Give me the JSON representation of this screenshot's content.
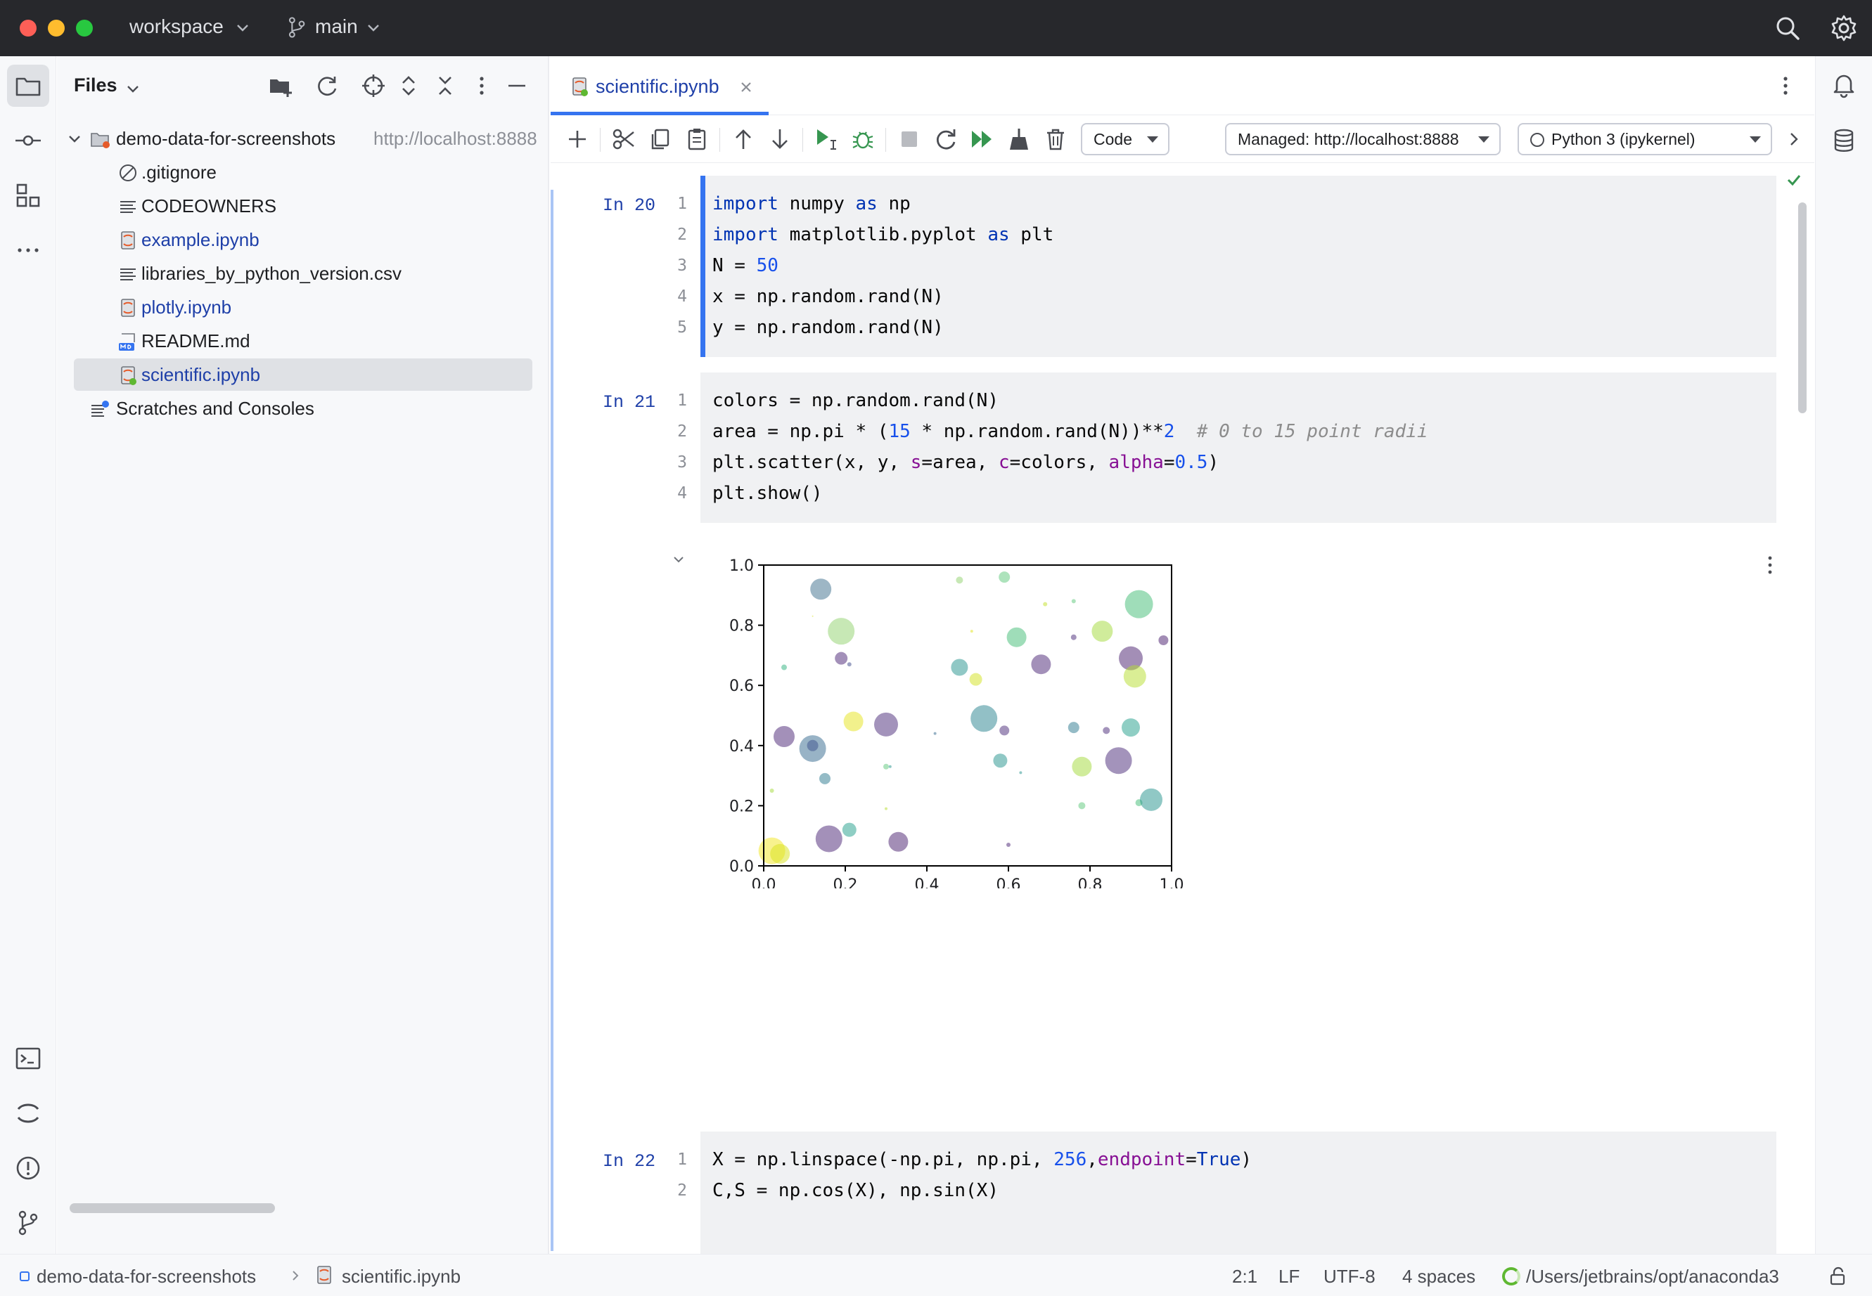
{
  "titlebar": {
    "project": "workspace",
    "branch": "main"
  },
  "project_panel": {
    "title": "Files",
    "root": {
      "name": "demo-data-for-screenshots",
      "url": "http://localhost:8888"
    },
    "items": [
      {
        "name": ".gitignore",
        "icon": "ignore-file-icon"
      },
      {
        "name": "CODEOWNERS",
        "icon": "text-file-icon"
      },
      {
        "name": "example.ipynb",
        "icon": "notebook-file-icon"
      },
      {
        "name": "libraries_by_python_version.csv",
        "icon": "text-file-icon"
      },
      {
        "name": "plotly.ipynb",
        "icon": "notebook-file-icon"
      },
      {
        "name": "README.md",
        "icon": "markdown-file-icon"
      },
      {
        "name": "scientific.ipynb",
        "icon": "notebook-file-icon"
      }
    ],
    "scratches": "Scratches and Consoles"
  },
  "editor": {
    "tab": "scientific.ipynb",
    "cell_type": "Code",
    "server": "Managed: http://localhost:8888",
    "kernel": "Python 3 (ipykernel)",
    "cells": [
      {
        "prompt": "In 20"
      },
      {
        "prompt": "In 21"
      },
      {
        "prompt": "In 22"
      }
    ]
  },
  "chart_data": {
    "type": "scatter",
    "xlim": [
      0,
      1
    ],
    "ylim": [
      0,
      1
    ],
    "xticks": [
      "0.0",
      "0.2",
      "0.4",
      "0.6",
      "0.8",
      "1.0"
    ],
    "yticks": [
      "0.0",
      "0.2",
      "0.4",
      "0.6",
      "0.8",
      "1.0"
    ],
    "grid": false,
    "points": [
      {
        "x": 0.14,
        "y": 0.92,
        "r": 15,
        "c": "#3b6d8c"
      },
      {
        "x": 0.48,
        "y": 0.95,
        "r": 5,
        "c": "#8fd16b"
      },
      {
        "x": 0.59,
        "y": 0.96,
        "r": 8,
        "c": "#5cc77a"
      },
      {
        "x": 0.69,
        "y": 0.87,
        "r": 3,
        "c": "#c2df23"
      },
      {
        "x": 0.76,
        "y": 0.88,
        "r": 3,
        "c": "#5cc77a"
      },
      {
        "x": 0.92,
        "y": 0.87,
        "r": 20,
        "c": "#3fbc73"
      },
      {
        "x": 0.12,
        "y": 0.83,
        "r": 1,
        "c": "#d8e219"
      },
      {
        "x": 0.19,
        "y": 0.78,
        "r": 19,
        "c": "#8fd16b"
      },
      {
        "x": 0.51,
        "y": 0.78,
        "r": 2,
        "c": "#e2e418"
      },
      {
        "x": 0.62,
        "y": 0.76,
        "r": 14,
        "c": "#3fbc73"
      },
      {
        "x": 0.76,
        "y": 0.76,
        "r": 4,
        "c": "#482878"
      },
      {
        "x": 0.83,
        "y": 0.78,
        "r": 15,
        "c": "#a2da37"
      },
      {
        "x": 0.98,
        "y": 0.75,
        "r": 7,
        "c": "#46196b"
      },
      {
        "x": 0.19,
        "y": 0.69,
        "r": 9,
        "c": "#482173"
      },
      {
        "x": 0.21,
        "y": 0.67,
        "r": 3,
        "c": "#3e4989"
      },
      {
        "x": 0.05,
        "y": 0.66,
        "r": 4,
        "c": "#2db27d"
      },
      {
        "x": 0.48,
        "y": 0.66,
        "r": 12,
        "c": "#21918c"
      },
      {
        "x": 0.68,
        "y": 0.67,
        "r": 14,
        "c": "#482173"
      },
      {
        "x": 0.9,
        "y": 0.69,
        "r": 17,
        "c": "#471d6e"
      },
      {
        "x": 0.91,
        "y": 0.63,
        "r": 16,
        "c": "#b5de2b"
      },
      {
        "x": 0.52,
        "y": 0.62,
        "r": 9,
        "c": "#d2e21b"
      },
      {
        "x": 0.22,
        "y": 0.48,
        "r": 14,
        "c": "#e5e419"
      },
      {
        "x": 0.3,
        "y": 0.47,
        "r": 17,
        "c": "#482878"
      },
      {
        "x": 0.05,
        "y": 0.43,
        "r": 15,
        "c": "#482173"
      },
      {
        "x": 0.54,
        "y": 0.49,
        "r": 19,
        "c": "#26828e"
      },
      {
        "x": 0.42,
        "y": 0.44,
        "r": 2,
        "c": "#31688e"
      },
      {
        "x": 0.59,
        "y": 0.45,
        "r": 7,
        "c": "#482878"
      },
      {
        "x": 0.76,
        "y": 0.46,
        "r": 8,
        "c": "#2a788e"
      },
      {
        "x": 0.84,
        "y": 0.45,
        "r": 5,
        "c": "#482878"
      },
      {
        "x": 0.9,
        "y": 0.46,
        "r": 13,
        "c": "#1f9e89"
      },
      {
        "x": 0.12,
        "y": 0.39,
        "r": 19,
        "c": "#31688e"
      },
      {
        "x": 0.12,
        "y": 0.4,
        "r": 8,
        "c": "#3b528b"
      },
      {
        "x": 0.15,
        "y": 0.29,
        "r": 8,
        "c": "#2a788e"
      },
      {
        "x": 0.3,
        "y": 0.33,
        "r": 4,
        "c": "#5cc77a"
      },
      {
        "x": 0.31,
        "y": 0.33,
        "r": 2,
        "c": "#21918c"
      },
      {
        "x": 0.58,
        "y": 0.35,
        "r": 10,
        "c": "#21918c"
      },
      {
        "x": 0.63,
        "y": 0.31,
        "r": 2,
        "c": "#21918c"
      },
      {
        "x": 0.78,
        "y": 0.33,
        "r": 14,
        "c": "#a2da37"
      },
      {
        "x": 0.87,
        "y": 0.35,
        "r": 19,
        "c": "#482878"
      },
      {
        "x": 0.02,
        "y": 0.25,
        "r": 3,
        "c": "#a2da37"
      },
      {
        "x": 0.3,
        "y": 0.19,
        "r": 2,
        "c": "#b5de2b"
      },
      {
        "x": 0.78,
        "y": 0.2,
        "r": 5,
        "c": "#5cc77a"
      },
      {
        "x": 0.92,
        "y": 0.21,
        "r": 5,
        "c": "#3fbc73"
      },
      {
        "x": 0.95,
        "y": 0.22,
        "r": 16,
        "c": "#21918c"
      },
      {
        "x": 0.21,
        "y": 0.12,
        "r": 10,
        "c": "#1f9e89"
      },
      {
        "x": 0.16,
        "y": 0.09,
        "r": 19,
        "c": "#482173"
      },
      {
        "x": 0.33,
        "y": 0.08,
        "r": 14,
        "c": "#471d6e"
      },
      {
        "x": 0.6,
        "y": 0.07,
        "r": 3,
        "c": "#482173"
      },
      {
        "x": 0.02,
        "y": 0.05,
        "r": 19,
        "c": "#f1e51d"
      },
      {
        "x": 0.04,
        "y": 0.04,
        "r": 14,
        "c": "#d8e219"
      }
    ]
  },
  "statusbar": {
    "crumb_project": "demo-data-for-screenshots",
    "crumb_file": "scientific.ipynb",
    "position": "2:1",
    "line_sep": "LF",
    "encoding": "UTF-8",
    "indent": "4 spaces",
    "interpreter": "/Users/jetbrains/opt/anaconda3"
  }
}
